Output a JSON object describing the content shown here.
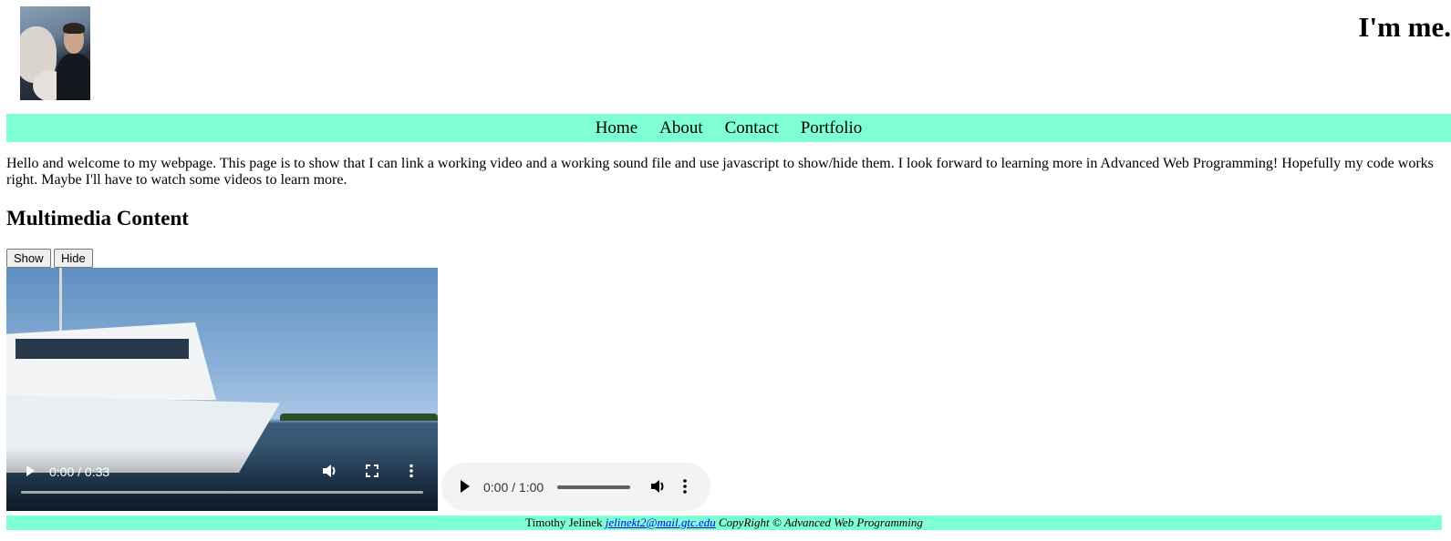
{
  "header": {
    "title": "I'm me.",
    "avatar_icon": "profile-photo"
  },
  "nav": {
    "items": [
      {
        "label": "Home"
      },
      {
        "label": "About"
      },
      {
        "label": "Contact"
      },
      {
        "label": "Portfolio"
      }
    ],
    "background_color": "#7fffd4"
  },
  "main": {
    "intro": "Hello and welcome to my webpage. This page is to show that I can link a working video and a working sound file and use javascript to show/hide them. I look forward to learning more in Advanced Web Programming! Hopefully my code works right. Maybe I'll have to watch some videos to learn more.",
    "heading": "Multimedia Content",
    "show_label": "Show",
    "hide_label": "Hide"
  },
  "video": {
    "time": "0:00 / 0:33",
    "progress": 0,
    "icons": [
      "play-icon",
      "volume-icon",
      "fullscreen-icon",
      "more-options-icon"
    ]
  },
  "audio": {
    "time": "0:00 / 1:00",
    "progress": 0,
    "icons": [
      "play-icon",
      "volume-icon",
      "more-options-icon"
    ]
  },
  "footer": {
    "name": "Timothy Jelinek",
    "email": "jelinekt2@mail.gtc.edu",
    "copyright": "CopyRight © Advanced Web Programming",
    "background_color": "#7fffd4"
  }
}
